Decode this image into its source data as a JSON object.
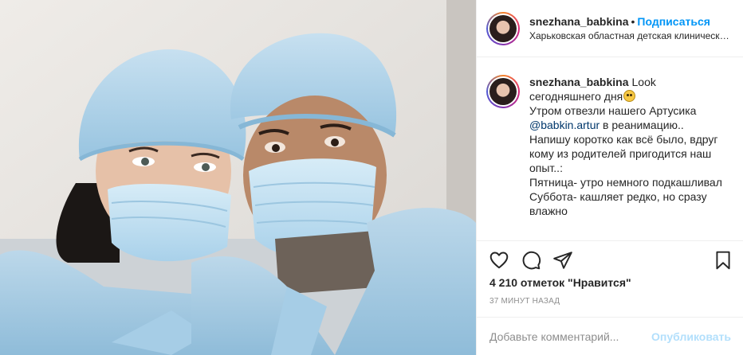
{
  "post": {
    "photo_alt": "",
    "header": {
      "username": "snezhana_babkina",
      "separator": "•",
      "follow_label": "Подписаться",
      "location": "Харьковская областная детская клиническая больница"
    },
    "caption": {
      "username": "snezhana_babkina",
      "text_part1": "Look сегодняшнего дня",
      "line2": "Утром отвезли нашего Артусика",
      "mention": "@babkin.artur",
      "line2_end": " в реанимацию..",
      "line3": "Напишу коротко как всё было, вдруг кому из родителей пригодится наш опыт..:",
      "line4": "Пятница- утро немного подкашливал",
      "line5": "Суббота- кашляет редко, но сразу влажно"
    },
    "actions": {
      "like_icon": "heart-icon",
      "comment_icon": "comment-icon",
      "share_icon": "share-icon",
      "save_icon": "bookmark-icon"
    },
    "likes_text": "4 210 отметок \"Нравится\"",
    "time_text": "37 минут назад",
    "comment": {
      "placeholder": "Добавьте комментарий...",
      "post_label": "Опубликовать"
    }
  },
  "colors": {
    "link": "#0095f6",
    "mention": "#00376b",
    "muted": "#8e8e8e",
    "post_disabled": "#b2dffc"
  }
}
